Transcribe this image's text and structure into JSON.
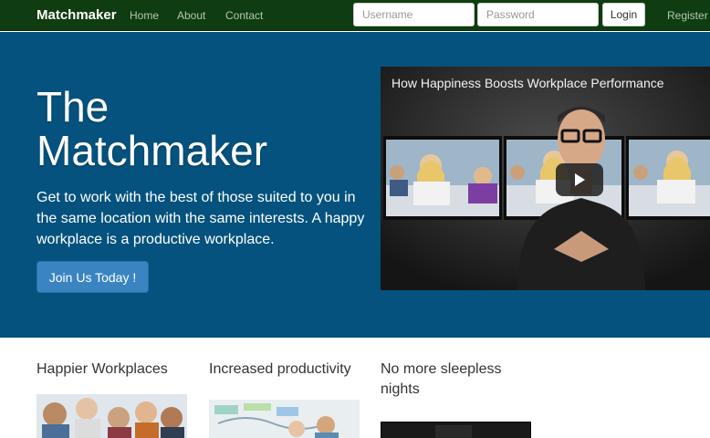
{
  "navbar": {
    "brand": "Matchmaker",
    "links": [
      {
        "label": "Home"
      },
      {
        "label": "About"
      },
      {
        "label": "Contact"
      }
    ],
    "username_placeholder": "Username",
    "password_placeholder": "Password",
    "login_label": "Login",
    "register_label": "Register"
  },
  "hero": {
    "title_line1": "The",
    "title_line2": "Matchmaker",
    "text": "Get to work with the best of those suited to you in the same location with the same interests. A happy workplace is a productive workplace.",
    "cta_label": "Join Us Today !"
  },
  "video": {
    "title": "How Happiness Boosts Workplace Performance",
    "play_icon": "play-icon"
  },
  "features": [
    {
      "heading": "Happier Workplaces"
    },
    {
      "heading": "Increased productivity"
    },
    {
      "heading": "No more sleepless nights"
    }
  ],
  "colors": {
    "navbar_bg": "#0f3c10",
    "hero_bg": "#04527d",
    "cta_bg": "#3a84c1"
  }
}
